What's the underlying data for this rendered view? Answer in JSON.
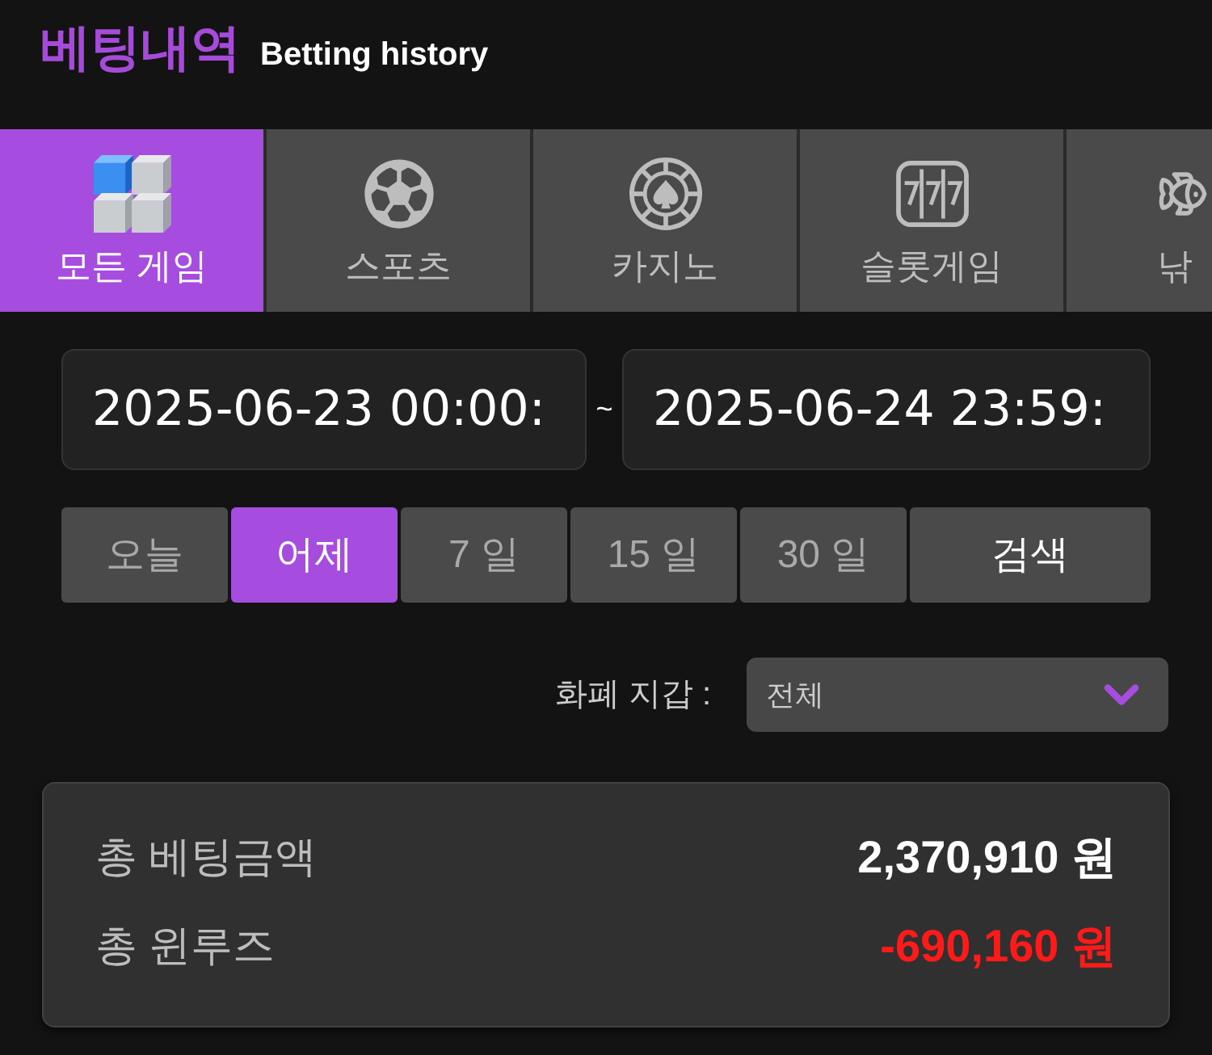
{
  "header": {
    "title": "베팅내역",
    "subtitle": "Betting history"
  },
  "tabs": [
    {
      "label": "모든 게임",
      "kind": "all",
      "selected": true
    },
    {
      "label": "스포츠",
      "kind": "sports",
      "selected": false
    },
    {
      "label": "카지노",
      "kind": "casino",
      "selected": false
    },
    {
      "label": "슬롯게임",
      "kind": "slot",
      "selected": false
    },
    {
      "label": "낚",
      "kind": "fishing",
      "selected": false
    }
  ],
  "date_filter": {
    "start": "2025-06-23 00:00:",
    "separator": "~",
    "end": "2025-06-24 23:59:"
  },
  "quick_ranges": [
    {
      "label": "오늘",
      "selected": false
    },
    {
      "label": "어제",
      "selected": true
    },
    {
      "label": "7 일",
      "selected": false
    },
    {
      "label": "15 일",
      "selected": false
    },
    {
      "label": "30 일",
      "selected": false
    }
  ],
  "search_button": "검색",
  "wallet": {
    "label": "화폐 지갑 :",
    "value": "전체"
  },
  "summary": [
    {
      "label": "총 베팅금액",
      "value": "2,370,910 원",
      "negative": false
    },
    {
      "label": "총 윈루즈",
      "value": "-690,160 원",
      "negative": true
    }
  ]
}
